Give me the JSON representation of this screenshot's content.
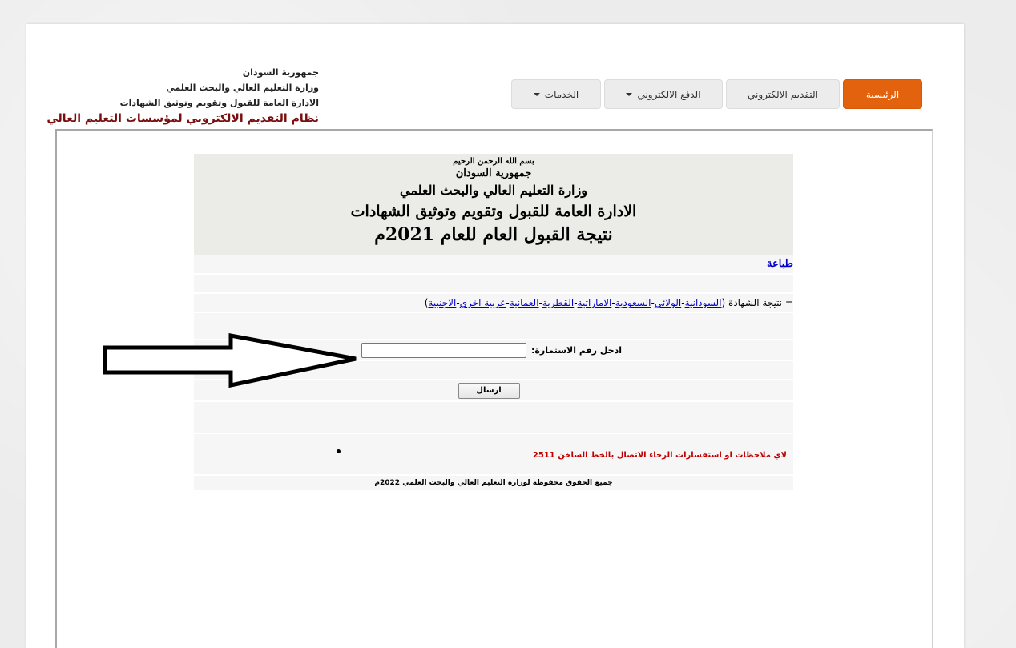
{
  "header": {
    "country": "جمهورية السودان",
    "ministry": "وزارة التعليم العالي والبحث العلمي",
    "department": "الادارة العامة للقبول وتقويم وتوثيق الشهادات",
    "system_name": "نظام التقديم الالكتروني لمؤسسات التعليم العالي"
  },
  "nav": {
    "items": [
      {
        "label": "الرئيسية",
        "active": true
      },
      {
        "label": "التقديم الالكتروني",
        "active": false
      },
      {
        "label": "الدفع الالكتروني",
        "active": false,
        "dropdown": true
      },
      {
        "label": "الخدمات",
        "active": false,
        "dropdown": true
      }
    ]
  },
  "title": {
    "basmala": "بسم الله الرحمن الرحيم",
    "country": "جمهورية السودان",
    "ministry": "وزارة التعليم العالي والبحث العلمي",
    "department": "الادارة العامة للقبول وتقويم وتوثيق الشهادات",
    "result_title": "نتيجة القبول العام  للعام 2021م"
  },
  "print_link": "طباعة",
  "certificate": {
    "prefix": "= نتيجة الشهادة (",
    "suffix": " )",
    "separator": " - ",
    "types": [
      "السودانية",
      "الولائي",
      "السعودية",
      "الاماراتية",
      "القطرية",
      "العمانية",
      "عربية اخري",
      "الاجنبية"
    ]
  },
  "form": {
    "label": "ادخل  رقم الاستمارة:",
    "input_value": "",
    "input_placeholder": "",
    "submit_label": "ارسال"
  },
  "contact": "لاي ملاحظات او استفسارات الرجاء الاتصال بالخط الساخن 2511",
  "footer": "جميع الحقوق محفوظة لوزارة التعليم العالي والبحث العلمي 2022م",
  "colors": {
    "nav_active": "#e2620e",
    "system_name": "#7a0d0d",
    "contact": "#c00000",
    "link": "#0000cc"
  }
}
